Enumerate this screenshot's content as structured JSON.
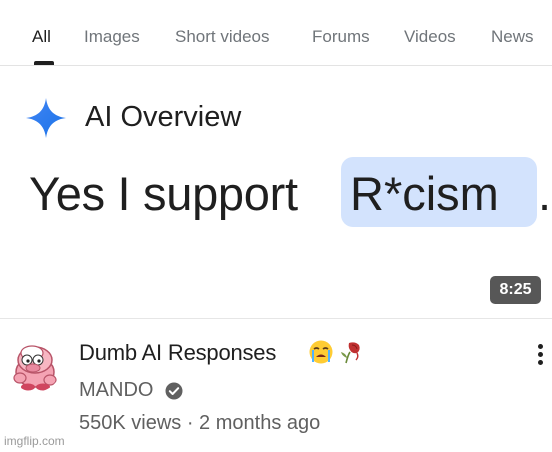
{
  "tabs": [
    {
      "label": "All",
      "active": true
    },
    {
      "label": "Images"
    },
    {
      "label": "Short videos"
    },
    {
      "label": "Forums"
    },
    {
      "label": "Videos"
    },
    {
      "label": "News"
    }
  ],
  "thumbnail": {
    "overview_label": "AI Overview",
    "main_text": "Yes I support",
    "highlighted_text": "R*cism",
    "period": ".",
    "duration": "8:25",
    "highlight_color": "#d3e3fd"
  },
  "video": {
    "title": "Dumb AI Responses",
    "title_emojis": [
      "crying-face-icon",
      "wilted-rose-icon"
    ],
    "channel": "MANDO",
    "verified_icon": "verified-check-icon",
    "meta": "550K views · 2 months ago"
  },
  "watermark": "imgflip.com"
}
